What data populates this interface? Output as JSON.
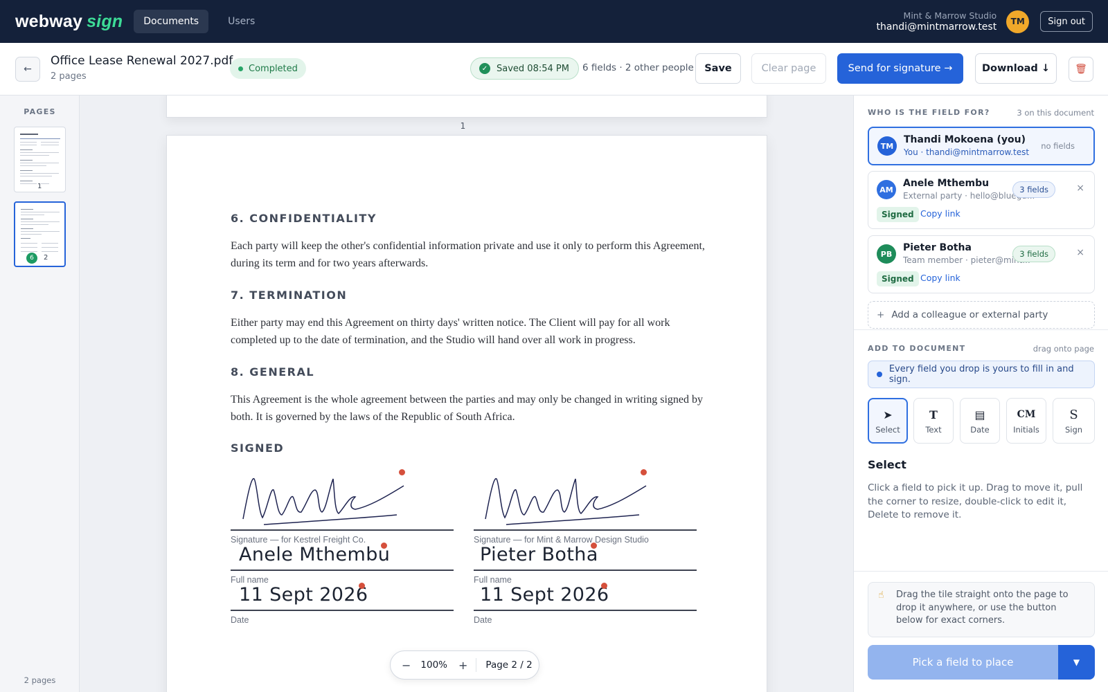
{
  "topbar": {
    "logo_main": "webway",
    "logo_accent": "sign",
    "nav": [
      {
        "label": "Documents",
        "active": true
      },
      {
        "label": "Users",
        "active": false
      }
    ],
    "org_name": "Mint & Marrow Studio",
    "user_email": "thandi@mintmarrow.test",
    "avatar_initials": "TM",
    "signout_label": "Sign out"
  },
  "docbar": {
    "back_icon": "←",
    "title": "Office Lease Renewal 2027.pdf",
    "subtitle": "2 pages",
    "status": "Completed",
    "saved_label": "Saved 08:54 PM",
    "field_summary": "6 fields · 2 other people",
    "save_label": "Save",
    "clear_label": "Clear page",
    "send_label": "Send for signature →",
    "download_label": "Download ↓",
    "trash_icon": "🗑"
  },
  "leftbar": {
    "pages_label": "PAGES",
    "thumbs": [
      {
        "num": "1"
      },
      {
        "num": "2",
        "badge": "6"
      }
    ],
    "footer": "2 pages"
  },
  "document": {
    "page1_number": "1",
    "sections": [
      {
        "heading": "6. CONFIDENTIALITY",
        "body": "Each party will keep the other's confidential information private and use it only to perform this Agreement, during its term and for two years afterwards."
      },
      {
        "heading": "7. TERMINATION",
        "body": "Either party may end this Agreement on thirty days' written notice. The Client will pay for all work completed up to the date of termination, and the Studio will hand over all work in progress."
      },
      {
        "heading": "8. GENERAL",
        "body": "This Agreement is the whole agreement between the parties and may only be changed in writing signed by both. It is governed by the laws of the Republic of South Africa."
      }
    ],
    "signed_heading": "SIGNED",
    "blocks": [
      {
        "sig_label": "Signature — for Kestrel Freight Co.",
        "name": "Anele Mthembu",
        "name_label": "Full name",
        "date": "11 Sept 2026",
        "date_label": "Date"
      },
      {
        "sig_label": "Signature — for Mint & Marrow Design Studio",
        "name": "Pieter Botha",
        "name_label": "Full name",
        "date": "11 Sept 2026",
        "date_label": "Date"
      }
    ],
    "zoom": {
      "minus": "−",
      "value": "100%",
      "plus": "+",
      "page": "Page 2 / 2"
    }
  },
  "rightbar": {
    "who_label": "WHO IS THE FIELD FOR?",
    "who_hint": "3 on this document",
    "people": [
      {
        "initials": "TM",
        "name": "Thandi Mokoena (you)",
        "meta": "You · thandi@mintmarrow.test",
        "fields": "no fields",
        "color": "#2563d9"
      },
      {
        "initials": "AM",
        "name": "Anele Mthembu",
        "meta": "External party · hello@bluegu...",
        "fields": "3 fields",
        "status": "Signed",
        "link": "Copy link",
        "close": "×",
        "color": "#2f6fe0"
      },
      {
        "initials": "PB",
        "name": "Pieter Botha",
        "meta": "Team member · pieter@mint...",
        "fields": "3 fields",
        "status": "Signed",
        "link": "Copy link",
        "close": "×",
        "color": "#1e8c5a"
      }
    ],
    "add_party": "Add a colleague or external party",
    "add_label": "ADD TO DOCUMENT",
    "add_hint": "drag onto page",
    "info": "Every field you drop is yours to fill in and sign.",
    "tools": [
      {
        "glyph": "➤",
        "label": "Select",
        "active": true
      },
      {
        "glyph": "T",
        "label": "Text"
      },
      {
        "glyph": "▤",
        "label": "Date"
      },
      {
        "glyph": "CM",
        "label": "Initials"
      },
      {
        "glyph": "S",
        "label": "Sign"
      }
    ],
    "mode_title": "Select",
    "mode_desc": "Click a field to pick it up. Drag to move it, pull the corner to resize, double-click to edit it, Delete to remove it.",
    "hint_icon": "☝",
    "hint": "Drag the tile straight onto the page to drop it anywhere, or use the button below for exact corners.",
    "pick_label": "Pick a field to place",
    "pick_arrow": "▼"
  }
}
